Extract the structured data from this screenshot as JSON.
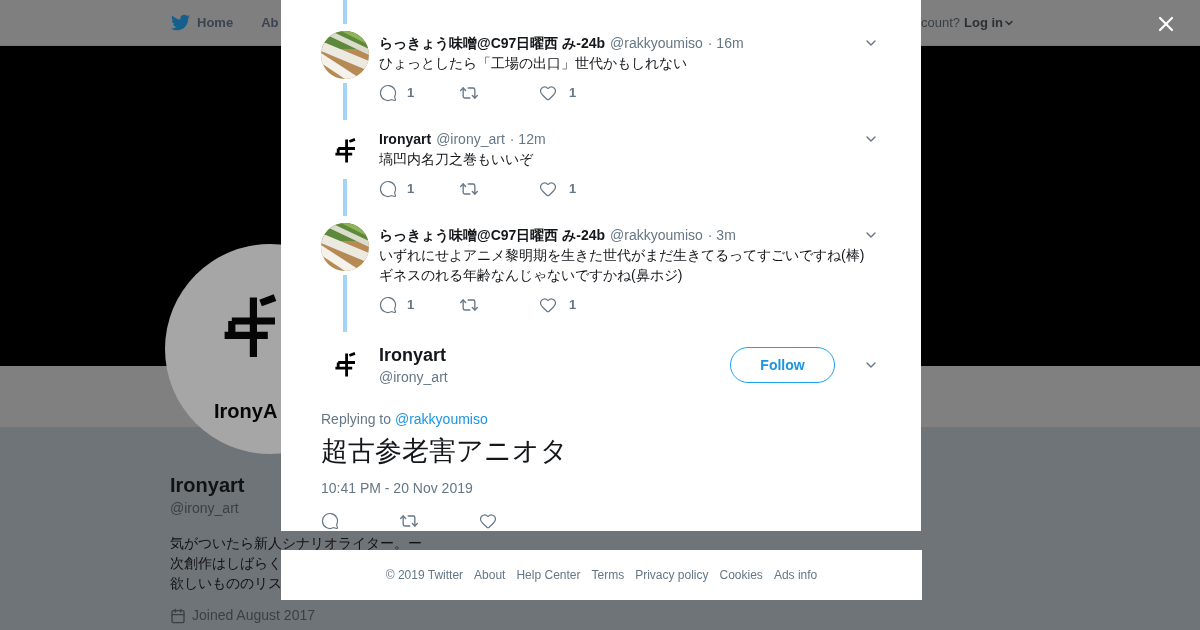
{
  "nav": {
    "items": [
      {
        "label": "Home"
      },
      {
        "label": "Ab"
      }
    ],
    "account_prompt": "count?",
    "login": "Log in"
  },
  "profile": {
    "avatar_wordmark": "IronyA",
    "name": "Ironyart",
    "handle": "@irony_art",
    "bio_lines": [
      "気がついたら新人シナリオライター。ー",
      "次創作はしばらく",
      "欲しいもののリス"
    ],
    "joined": "Joined August 2017"
  },
  "replies": [
    {
      "name": "らっきょう味噌@C97日曜西 み-24b",
      "handle": "@rakkyoumiso",
      "time": "· 16m",
      "avatar": {
        "kind": "picture"
      },
      "text_lines": [
        "ひょっとしたら「工場の出口」世代かもしれない"
      ],
      "reply_count": "1",
      "like_count": "1"
    },
    {
      "name": "Ironyart",
      "handle": "@irony_art",
      "time": "· 12m",
      "avatar": {
        "kind": "logo"
      },
      "text_lines": [
        "塙凹内名刀之巻もいいぞ"
      ],
      "reply_count": "1",
      "like_count": "1"
    },
    {
      "name": "らっきょう味噌@C97日曜西 み-24b",
      "handle": "@rakkyoumiso",
      "time": "· 3m",
      "avatar": {
        "kind": "picture"
      },
      "text_lines": [
        "いずれにせよアニメ黎明期を生きた世代がまだ生きてるってすごいですね(棒)",
        "ギネスのれる年齢なんじゃないですかね(鼻ホジ)"
      ],
      "reply_count": "1",
      "like_count": "1"
    }
  ],
  "main_tweet": {
    "name": "Ironyart",
    "handle": "@irony_art",
    "avatar": {
      "kind": "logo"
    },
    "follow": "Follow",
    "replying_label": "Replying to",
    "replying_handle": "@rakkyoumiso",
    "text": "超古参老害アニオタ",
    "timestamp": "10:41 PM - 20 Nov 2019"
  },
  "footer": [
    "© 2019 Twitter",
    "About",
    "Help Center",
    "Terms",
    "Privacy policy",
    "Cookies",
    "Ads info"
  ]
}
